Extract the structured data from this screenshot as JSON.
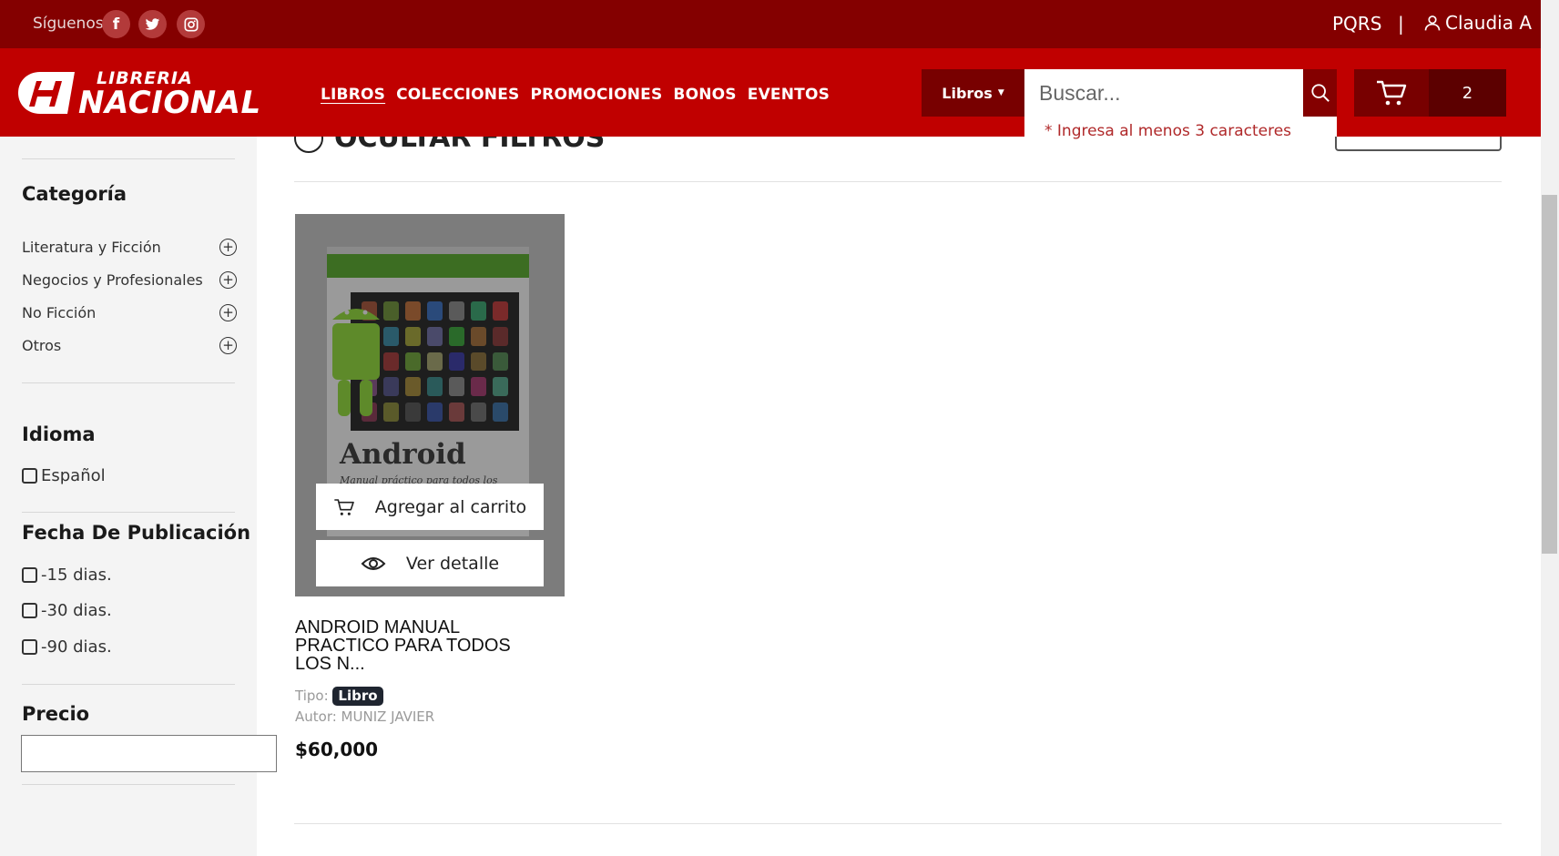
{
  "topbar": {
    "follow_label": "Síguenos",
    "social": [
      {
        "name": "facebook",
        "glyph": "f"
      },
      {
        "name": "twitter",
        "glyph": "t"
      },
      {
        "name": "instagram",
        "glyph": "◎"
      }
    ],
    "pqrs": "PQRS",
    "separator": "|",
    "user_name": "Claudia A"
  },
  "header": {
    "logo_line1": "LIBRERIA",
    "logo_line2": "NACIONAL",
    "nav": [
      "LIBROS",
      "COLECCIONES",
      "PROMOCIONES",
      "BONOS",
      "EVENTOS"
    ],
    "active_nav": "LIBROS",
    "search_type": "Libros",
    "search_placeholder": "Buscar...",
    "search_hint": "* Ingresa al menos 3 caracteres",
    "cart_count": "2"
  },
  "sidebar": {
    "category_title": "Categoría",
    "categories": [
      "Literatura y Ficción",
      "Negocios y Profesionales",
      "No Ficción",
      "Otros"
    ],
    "language_title": "Idioma",
    "languages": [
      "Español"
    ],
    "date_title": "Fecha De Publicación",
    "date_options": [
      "-15 dias.",
      "-30 dias.",
      "-90 dias."
    ],
    "price_title": "Precio"
  },
  "content": {
    "hide_filters": "OCULTAR FILTROS"
  },
  "product": {
    "title": "ANDROID MANUAL PRACTICO PARA TODOS LOS N...",
    "type_label": "Tipo:",
    "type_value": "Libro",
    "author": "Autor: MUNIZ JAVIER",
    "price": "$60,000",
    "add_to_cart": "Agregar al carrito",
    "view_detail": "Ver detalle",
    "cover_title": "Android",
    "cover_subtitle": "Manual práctico para todos los niveles"
  },
  "colors": {
    "topbar": "#840000",
    "header": "#c00000",
    "accent_dark": "#780000"
  }
}
